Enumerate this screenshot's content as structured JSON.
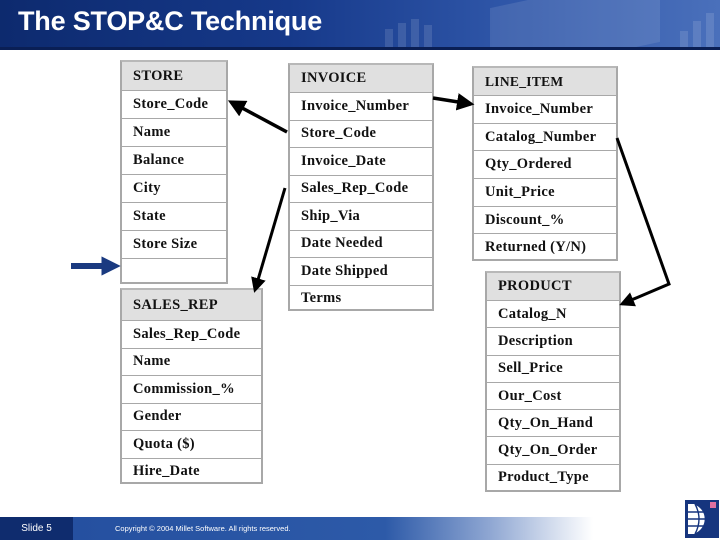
{
  "slide": {
    "title": "The STOP&C Technique",
    "footer": {
      "slide_label": "Slide 5",
      "copyright": "Copyright © 2004 Millet Software. All rights reserved."
    },
    "colors": {
      "header_blue": "#0d2a6e",
      "table_header_fill": "#e0e0e0",
      "table_border": "#a8a8a8",
      "pointer_arrow": "#1a3a80"
    }
  },
  "tables": {
    "store": {
      "name": "STORE",
      "fields": [
        "Store_Code",
        "Name",
        "Balance",
        "City",
        "State",
        "Store Size",
        ""
      ]
    },
    "invoice": {
      "name": "INVOICE",
      "fields": [
        "Invoice_Number",
        "Store_Code",
        "Invoice_Date",
        "Sales_Rep_Code",
        "Ship_Via",
        "Date Needed",
        "Date Shipped",
        "Terms"
      ]
    },
    "line_item": {
      "name": "LINE_ITEM",
      "fields": [
        "Invoice_Number",
        "Catalog_Number",
        "Qty_Ordered",
        "Unit_Price",
        "Discount_%",
        "Returned (Y/N)"
      ]
    },
    "sales_rep": {
      "name": "SALES_REP",
      "fields": [
        "Sales_Rep_Code",
        "Name",
        "Commission_%",
        "Gender",
        "Quota ($)",
        "Hire_Date"
      ]
    },
    "product": {
      "name": "PRODUCT",
      "fields": [
        "Catalog_N",
        "Description",
        "Sell_Price",
        "Our_Cost",
        "Qty_On_Hand",
        "Qty_On_Order",
        "Product_Type"
      ]
    }
  },
  "relationships": [
    {
      "from": "INVOICE.Store_Code",
      "to": "STORE.Store_Code"
    },
    {
      "from": "INVOICE.Invoice_Number",
      "to": "LINE_ITEM.Invoice_Number"
    },
    {
      "from": "INVOICE.Sales_Rep_Code",
      "to": "SALES_REP"
    },
    {
      "from": "LINE_ITEM.Catalog_Number",
      "to": "PRODUCT.Catalog_N"
    }
  ]
}
